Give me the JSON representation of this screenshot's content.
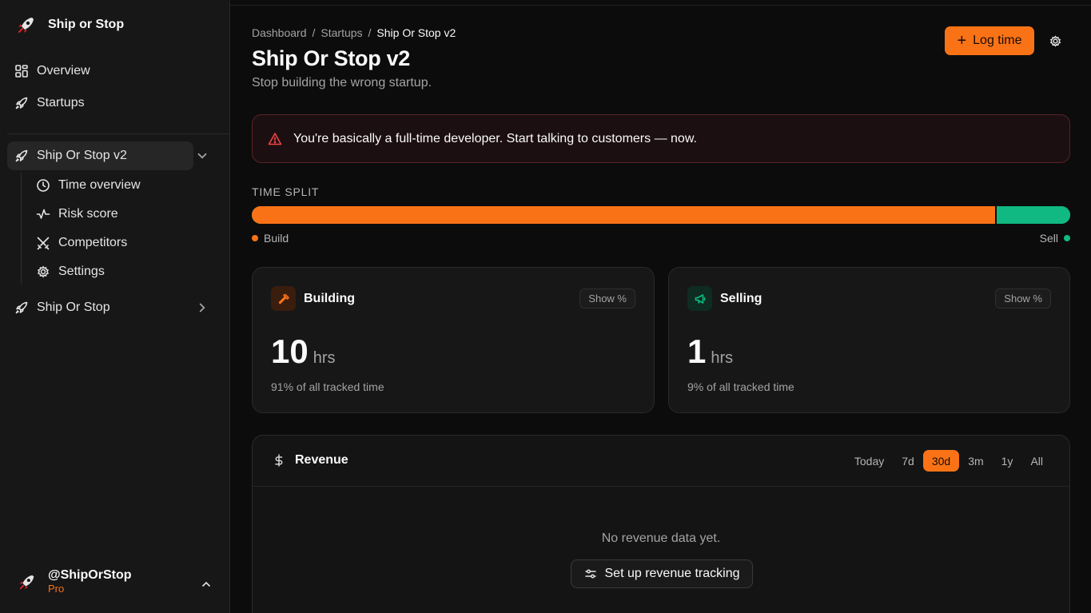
{
  "brand": {
    "name": "Ship or Stop"
  },
  "nav": {
    "overview": "Overview",
    "startups": "Startups",
    "active_startup": "Ship Or Stop v2",
    "sub_items": [
      "Time overview",
      "Risk score",
      "Competitors",
      "Settings"
    ],
    "other_startup": "Ship Or Stop"
  },
  "user": {
    "handle": "@ShipOrStop",
    "plan": "Pro"
  },
  "header": {
    "breadcrumb": [
      "Dashboard",
      "Startups",
      "Ship Or Stop v2"
    ],
    "title": "Ship Or Stop v2",
    "subtitle": "Stop building the wrong startup.",
    "log_time": "Log time"
  },
  "alert": {
    "text": "You're basically a full-time developer. Start talking to customers — now."
  },
  "time_split": {
    "label": "TIME SPLIT",
    "build_fraction": 0.91,
    "build_label": "Build",
    "sell_label": "Sell"
  },
  "cards": {
    "building": {
      "title": "Building",
      "show": "Show %",
      "value": "10",
      "unit": "hrs",
      "foot": "91% of all tracked time"
    },
    "selling": {
      "title": "Selling",
      "show": "Show %",
      "value": "1",
      "unit": "hrs",
      "foot": "9% of all tracked time"
    }
  },
  "revenue": {
    "title": "Revenue",
    "ranges": [
      "Today",
      "7d",
      "30d",
      "3m",
      "1y",
      "All"
    ],
    "selected_range": "30d",
    "empty": "No revenue data yet.",
    "setup": "Set up revenue tracking"
  },
  "colors": {
    "accent": "#f97316",
    "sell": "#10b981",
    "alert_border": "#5b2226"
  }
}
